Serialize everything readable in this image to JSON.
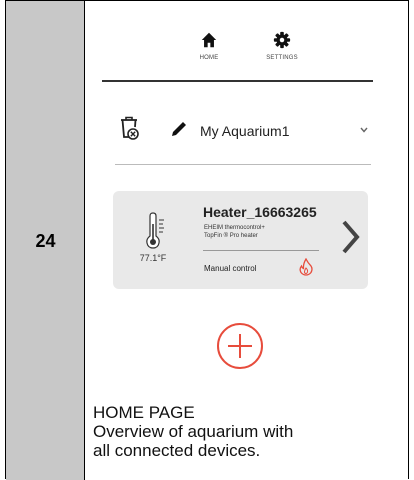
{
  "step": {
    "number": "24"
  },
  "nav": {
    "tabs": [
      {
        "label": "HOME",
        "icon": "home-icon"
      },
      {
        "label": "SETTINGS",
        "icon": "gear-icon"
      }
    ]
  },
  "aquarium": {
    "selected": "My Aquarium1"
  },
  "device": {
    "name": "Heater_16663265",
    "model_line1": "EHEIM thermocontrol+",
    "model_line2": "TopFin ® Pro heater",
    "temperature": "77.1°F",
    "mode": "Manual control",
    "status_icon": "flame-icon",
    "flame_color": "#e74c3c"
  },
  "add_button": {
    "icon": "plus-icon",
    "color": "#e74c3c"
  },
  "caption": {
    "title": "HOME PAGE",
    "line1": "Overview of aquarium with",
    "line2": "all connected devices."
  }
}
